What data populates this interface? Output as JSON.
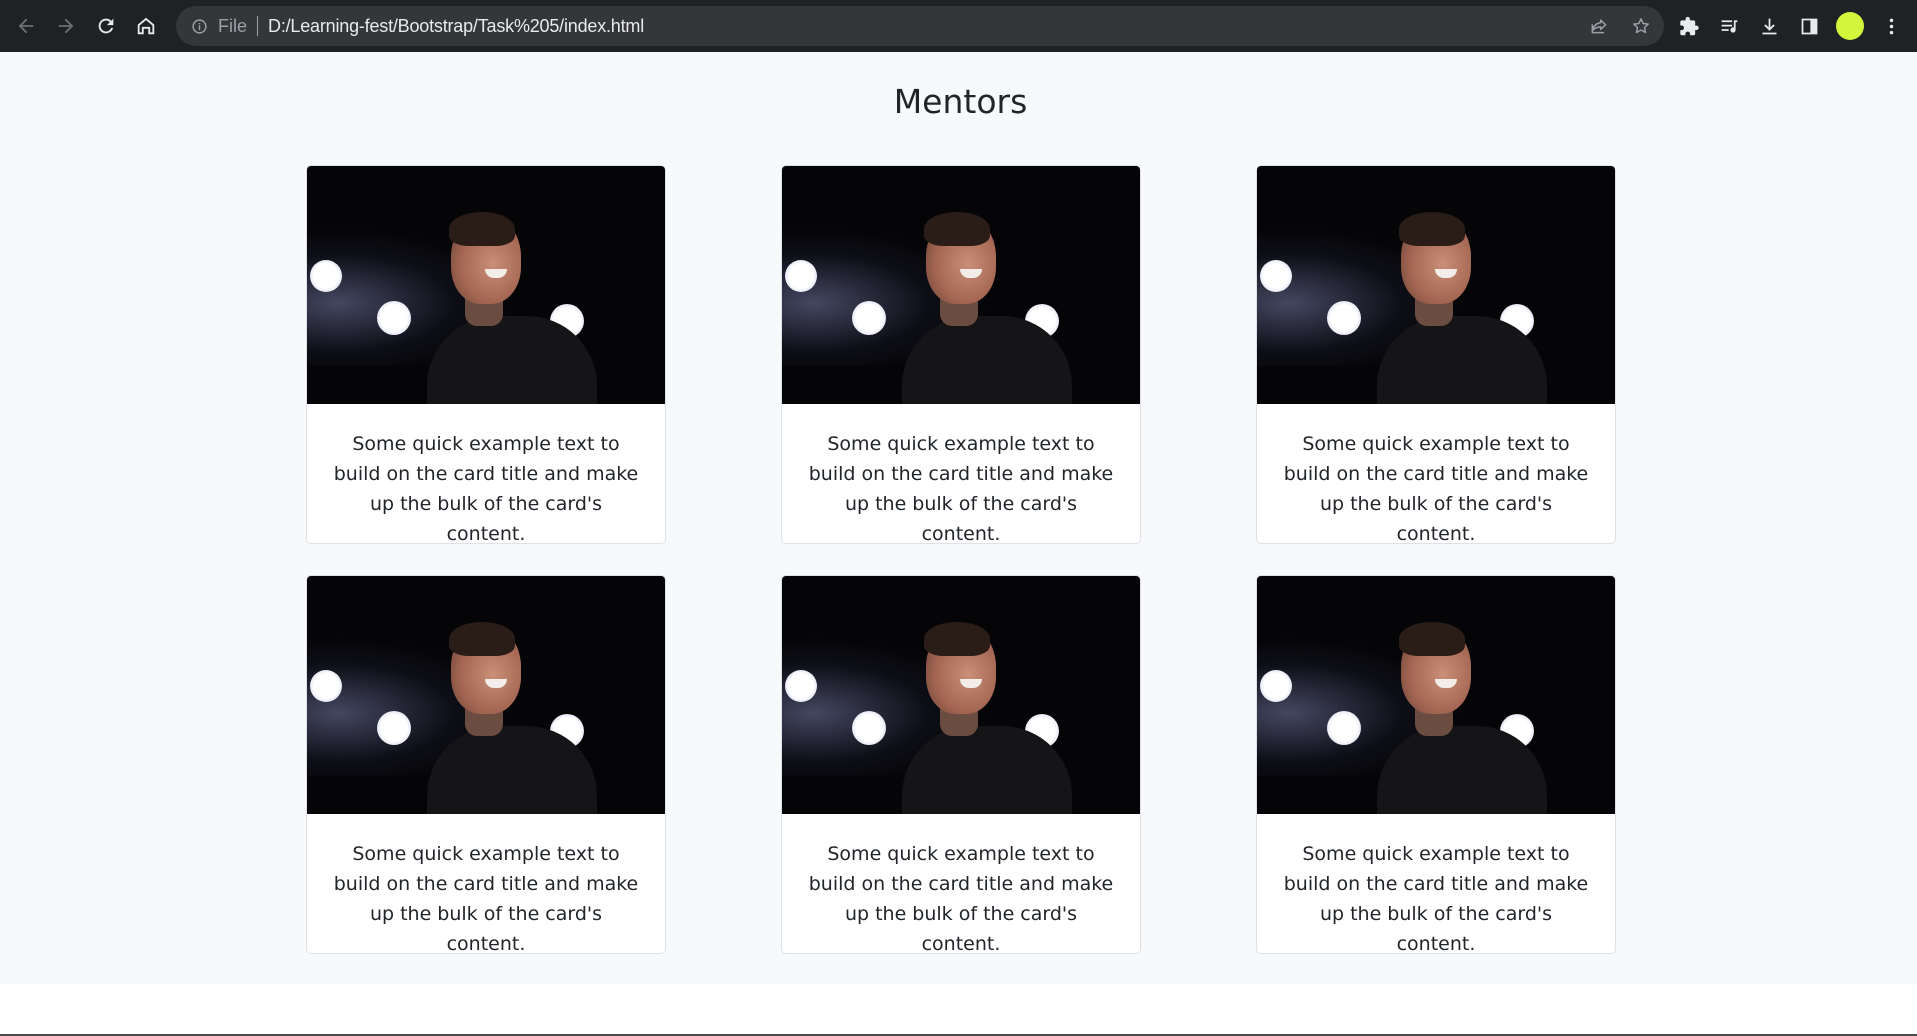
{
  "browser": {
    "scheme_label": "File",
    "url": "D:/Learning-fest/Bootstrap/Task%205/index.html",
    "avatar_color": "#d4f53c"
  },
  "page": {
    "heading": "Mentors",
    "cards": [
      {
        "text": "Some quick example text to build on the card title and make up the bulk of the card's content."
      },
      {
        "text": "Some quick example text to build on the card title and make up the bulk of the card's content."
      },
      {
        "text": "Some quick example text to build on the card title and make up the bulk of the card's content."
      },
      {
        "text": "Some quick example text to build on the card title and make up the bulk of the card's content."
      },
      {
        "text": "Some quick example text to build on the card title and make up the bulk of the card's content."
      },
      {
        "text": "Some quick example text to build on the card title and make up the bulk of the card's content."
      }
    ]
  }
}
